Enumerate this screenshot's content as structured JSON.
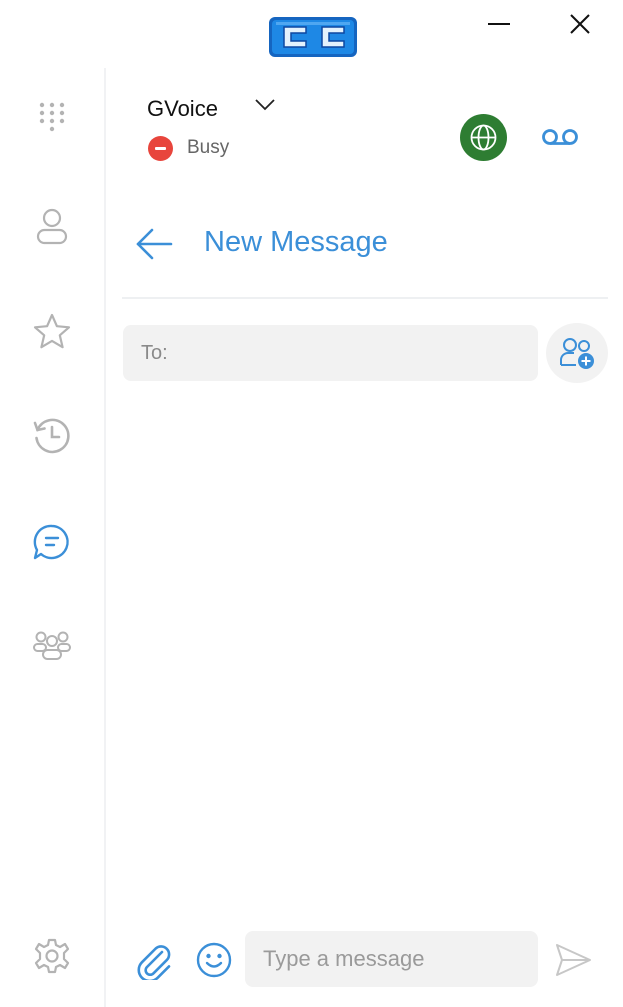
{
  "app": {
    "logo_text": "CC",
    "window_controls": {
      "minimize": "minimize-icon",
      "close": "close-icon"
    }
  },
  "sidebar": {
    "items": [
      {
        "name": "dialpad",
        "icon": "dialpad-icon",
        "active": false
      },
      {
        "name": "contacts",
        "icon": "user-icon",
        "active": false
      },
      {
        "name": "favorites",
        "icon": "star-icon",
        "active": false
      },
      {
        "name": "history",
        "icon": "history-icon",
        "active": false
      },
      {
        "name": "messages",
        "icon": "chat-icon",
        "active": true
      },
      {
        "name": "groups",
        "icon": "group-icon",
        "active": false
      }
    ],
    "settings_icon": "gear-icon"
  },
  "header": {
    "account_name": "GVoice",
    "status_label": "Busy",
    "status_color": "#e8453c",
    "globe_color": "#2e7d32",
    "voicemail_icon": "voicemail-icon"
  },
  "page": {
    "title": "New Message",
    "to_placeholder": "To:",
    "to_value": ""
  },
  "composer": {
    "placeholder": "Type a message",
    "value": ""
  },
  "colors": {
    "accent": "#3b8fd8",
    "icon_gray": "#b3b3b3",
    "field_bg": "#f2f2f2"
  }
}
